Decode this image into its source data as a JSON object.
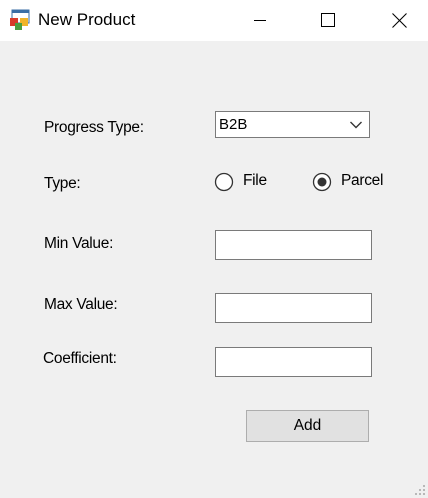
{
  "window": {
    "title": "New Product",
    "app_icon": "form-window-icon",
    "controls": {
      "minimize_icon": "minimize-icon",
      "maximize_icon": "maximize-icon",
      "close_icon": "close-icon"
    }
  },
  "form": {
    "progress_type": {
      "label": "Progress Type:",
      "selected": "B2B",
      "dropdown_icon": "chevron-down-icon"
    },
    "type": {
      "label": "Type:",
      "options": [
        {
          "label": "File",
          "checked": false
        },
        {
          "label": "Parcel",
          "checked": true
        }
      ]
    },
    "min_value": {
      "label": "Min Value:",
      "value": ""
    },
    "max_value": {
      "label": "Max Value:",
      "value": ""
    },
    "coefficient": {
      "label": "Coefficient:",
      "value": ""
    },
    "add_button": {
      "label": "Add"
    }
  },
  "colors": {
    "client_background": "#f0f0f0",
    "titlebar_background": "#ffffff",
    "button_face": "#e1e1e1",
    "button_border": "#adadad",
    "input_border": "#7a7a7a"
  }
}
